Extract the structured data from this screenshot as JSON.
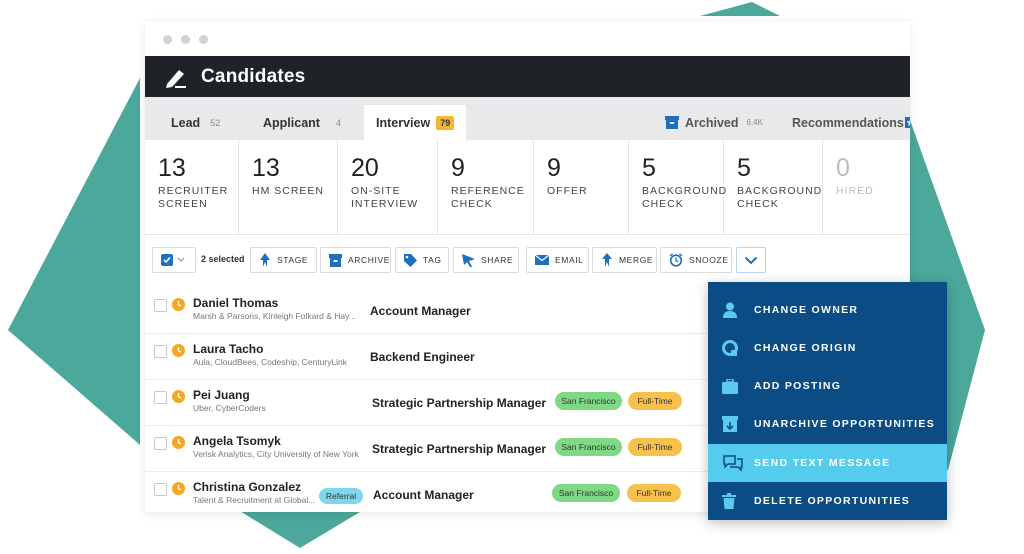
{
  "app": {
    "title": "Candidates"
  },
  "tabs": [
    {
      "label": "Lead",
      "count": "52"
    },
    {
      "label": "Applicant",
      "count": "4"
    },
    {
      "label": "Interview",
      "count": "79"
    }
  ],
  "tabs_right": {
    "archived_label": "Archived",
    "archived_count": "6.4K",
    "recommendations_label": "Recommendations"
  },
  "stages": [
    {
      "num": "13",
      "label": "RECRUITER\nSCREEN"
    },
    {
      "num": "13",
      "label": "HM SCREEN"
    },
    {
      "num": "20",
      "label": "ON-SITE\nINTERVIEW"
    },
    {
      "num": "9",
      "label": "REFERENCE\nCHECK"
    },
    {
      "num": "9",
      "label": "OFFER"
    },
    {
      "num": "5",
      "label": "BACKGROUND\nCHECK"
    },
    {
      "num": "5",
      "label": "BACKGROUND\nCHECK"
    },
    {
      "num": "0",
      "label": "HIRED"
    }
  ],
  "toolbar": {
    "selected": "2 selected",
    "stage": "STAGE",
    "archive": "ARCHIVE",
    "tag": "TAG",
    "share": "SHARE",
    "email": "EMAIL",
    "merge": "MERGE",
    "snooze": "SNOOZE"
  },
  "candidates": [
    {
      "name": "Daniel Thomas",
      "sub": "Marsh & Parsons, Kinleigh Folkard & Hay...",
      "role": "Account Manager"
    },
    {
      "name": "Laura Tacho",
      "sub": "Aula, CloudBees, Codeship, CenturyLink",
      "role": "Backend Engineer"
    },
    {
      "name": "Pei Juang",
      "sub": "Uber, CyberCoders",
      "role": "Strategic Partnership Manager",
      "location": "San Francisco",
      "type": "Full-Time"
    },
    {
      "name": "Angela Tsomyk",
      "sub": "Verisk Analytics, City University of New York",
      "role": "Strategic Partnership Manager",
      "location": "San Francisco",
      "type": "Full-Time"
    },
    {
      "name": "Christina Gonzalez",
      "sub": "Talent & Recruitment at Global...",
      "tag": "Referral",
      "role": "Account Manager",
      "location": "San Francisco",
      "type": "Full-Time"
    }
  ],
  "dropdown": [
    {
      "label": "CHANGE OWNER",
      "icon": "user-icon"
    },
    {
      "label": "CHANGE ORIGIN",
      "icon": "origin-icon"
    },
    {
      "label": "ADD POSTING",
      "icon": "briefcase-icon"
    },
    {
      "label": "UNARCHIVE OPPORTUNITIES",
      "icon": "unarchive-icon"
    },
    {
      "label": "SEND TEXT MESSAGE",
      "icon": "chat-icon"
    },
    {
      "label": "DELETE OPPORTUNITIES",
      "icon": "trash-icon"
    }
  ],
  "colors": {
    "accent": "#1f6fbf",
    "dropdown_bg": "#0a4c83",
    "dropdown_highlight": "#55cbee",
    "teal": "#4ba89b",
    "badge": "#f5b731"
  }
}
